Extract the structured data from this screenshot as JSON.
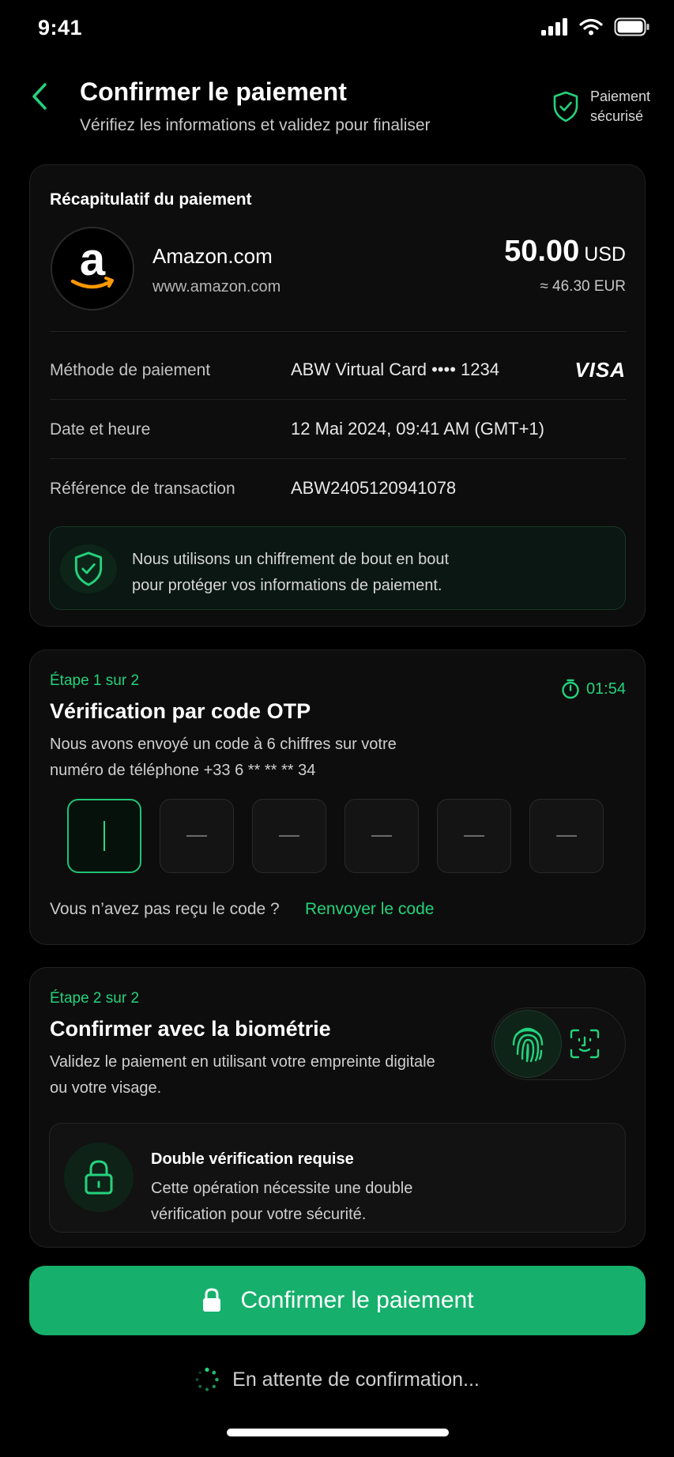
{
  "status_bar": {
    "time": "9:41"
  },
  "header": {
    "title": "Confirmer le paiement",
    "subtitle": "Vérifiez les informations et validez pour finaliser",
    "secure_line1": "Paiement",
    "secure_line2": "sécurisé"
  },
  "summary": {
    "title": "Récapitulatif du paiement",
    "merchant_name": "Amazon.com",
    "merchant_url": "www.amazon.com",
    "amount": "50.00",
    "currency": "USD",
    "amount_converted": "≈ 46.30 EUR",
    "rows": [
      {
        "label": "Méthode de paiement",
        "value": "ABW Virtual Card •••• 1234"
      },
      {
        "label": "Date et heure",
        "value": "12 Mai 2024, 09:41 AM (GMT+1)"
      },
      {
        "label": "Référence de transaction",
        "value": "ABW2405120941078"
      }
    ],
    "card_brand": "VISA",
    "encryption_line1": "Nous utilisons un chiffrement de bout en bout",
    "encryption_line2": "pour protéger vos informations de paiement."
  },
  "otp": {
    "step": "Étape 1 sur 2",
    "title": "Vérification par code OTP",
    "desc_line1": "Nous avons envoyé un code à 6 chiffres sur votre",
    "desc_line2": "numéro de téléphone +33 6 ** ** ** 34",
    "timer": "01:54",
    "digits": [
      "",
      "",
      "",
      "",
      "",
      ""
    ],
    "resend_question": "Vous n’avez pas reçu le code ?",
    "resend_link": "Renvoyer le code"
  },
  "biometric": {
    "step": "Étape 2 sur 2",
    "title": "Confirmer avec la biométrie",
    "desc_line1": "Validez le paiement en utilisant votre empreinte digitale",
    "desc_line2": "ou votre visage.",
    "double_title": "Double vérification requise",
    "double_line1": "Cette opération nécessite une double",
    "double_line2": "vérification pour votre sécurité."
  },
  "confirm_button": "Confirmer le paiement",
  "waiting_text": "En attente de confirmation...",
  "colors": {
    "accent": "#24d27c",
    "button": "#16b06c",
    "background": "#000000",
    "card": "#0d0d0d"
  }
}
